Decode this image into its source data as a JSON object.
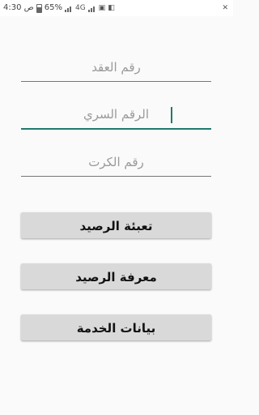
{
  "status_bar": {
    "time": "4:30 ص",
    "battery": "65%",
    "network": "4G"
  },
  "form": {
    "contract_placeholder": "رقم العقد",
    "pin_placeholder": "الرقم السري",
    "card_placeholder": "رقم الكرت"
  },
  "buttons": {
    "recharge": "تعبئة الرصيد",
    "check_balance": "معرفة الرصيد",
    "service_info": "بيانات الخدمة"
  }
}
